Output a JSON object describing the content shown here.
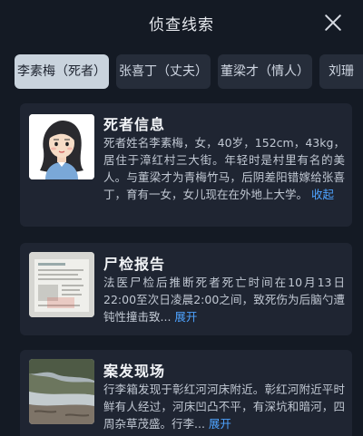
{
  "header": {
    "title": "侦查线索"
  },
  "tabs": [
    {
      "label": "李素梅（死者）",
      "active": true
    },
    {
      "label": "张喜丁（丈夫）",
      "active": false
    },
    {
      "label": "董梁才（情人）",
      "active": false
    },
    {
      "label": "刘珊",
      "active": false
    }
  ],
  "cards": [
    {
      "title": "死者信息",
      "text": "死者姓名李素梅，女，40岁，152cm，43kg，居住于漳红村三大街。年轻时是村里有名的美人。与董梁才为青梅竹马，后阴差阳错嫁给张喜丁，育有一女，女儿现在在外地上大学。",
      "toggle": "收起",
      "thumb_icon": "woman-portrait-icon"
    },
    {
      "title": "尸检报告",
      "text": "法医尸检后推断死者死亡时间在10月13日22:00至次日凌晨2:00之间，致死伤为后脑勺遭钝性撞击致...",
      "toggle": "展开",
      "thumb_icon": "document-photo-icon"
    },
    {
      "title": "案发现场",
      "text": "行李箱发现于彰红河河床附近。彰红河附近平时鲜有人经过，河床凹凸不平，有深坑和暗河，四周杂草茂盛。行李...",
      "toggle": "展开",
      "thumb_icon": "river-scene-icon"
    }
  ]
}
